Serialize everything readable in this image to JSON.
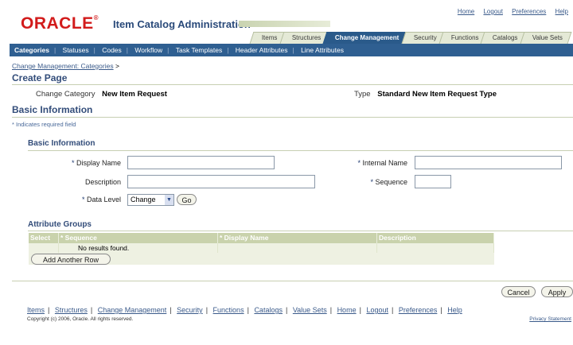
{
  "brand": {
    "logo": "ORACLE",
    "app_title": "Item Catalog Administration"
  },
  "global_links": [
    "Home",
    "Logout",
    "Preferences",
    "Help"
  ],
  "tabs": [
    {
      "label": "Items",
      "active": false
    },
    {
      "label": "Structures",
      "active": false
    },
    {
      "label": "Change Management",
      "active": true
    },
    {
      "label": "Security",
      "active": false
    },
    {
      "label": "Functions",
      "active": false
    },
    {
      "label": "Catalogs",
      "active": false
    },
    {
      "label": "Value Sets",
      "active": false
    }
  ],
  "subtabs": [
    "Categories",
    "Statuses",
    "Codes",
    "Workflow",
    "Task Templates",
    "Header Attributes",
    "Line Attributes"
  ],
  "breadcrumb": {
    "link": "Change Management: Categories",
    "sep": ">"
  },
  "page_title": "Create Page",
  "info": {
    "change_category_label": "Change Category",
    "change_category_value": "New Item Request",
    "type_label": "Type",
    "type_value": "Standard New Item Request Type"
  },
  "section_title": "Basic Information",
  "required_note": "* Indicates required field",
  "basic_info": {
    "title": "Basic Information",
    "display_name_label": "Display Name",
    "display_name_value": "",
    "internal_name_label": "Internal Name",
    "internal_name_value": "",
    "description_label": "Description",
    "description_value": "",
    "sequence_label": "Sequence",
    "sequence_value": "",
    "data_level_label": "Data Level",
    "data_level_value": "Change",
    "go_label": "Go"
  },
  "attribute_groups": {
    "title": "Attribute Groups",
    "columns": [
      "Select",
      "Sequence",
      "Display Name",
      "Description"
    ],
    "empty_message": "No results found.",
    "add_row_label": "Add Another Row"
  },
  "actions": {
    "cancel": "Cancel",
    "apply": "Apply"
  },
  "footer_links": [
    "Items",
    "Structures",
    "Change Management",
    "Security",
    "Functions",
    "Catalogs",
    "Value Sets",
    "Home",
    "Logout",
    "Preferences",
    "Help"
  ],
  "copyright": "Copyright (c) 2006, Oracle. All rights reserved.",
  "privacy": "Privacy Statement",
  "colors": {
    "brand_red": "#d21b1b",
    "nav_blue": "#2f5f91",
    "grid_header": "#c9d2ac"
  }
}
